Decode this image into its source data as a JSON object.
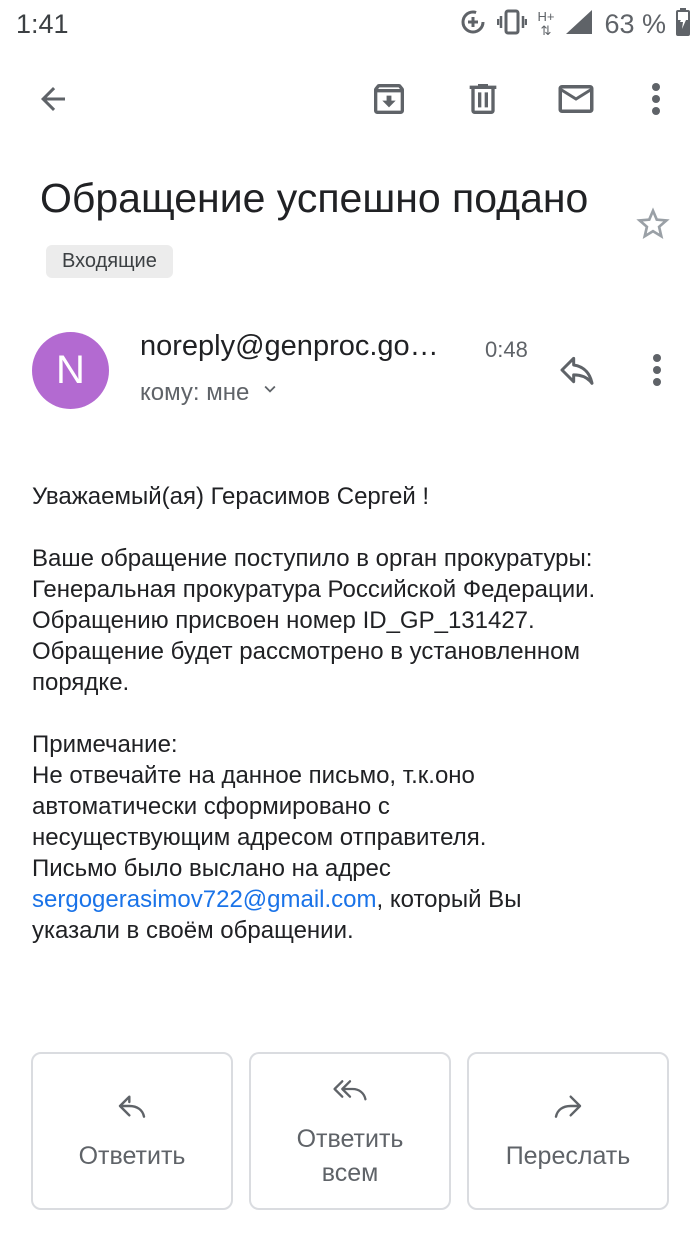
{
  "status_bar": {
    "time": "1:41",
    "network": "H+",
    "battery": "63 %"
  },
  "toolbar": {
    "back": "arrow-back-icon",
    "archive": "archive-icon",
    "delete": "delete-icon",
    "mark_unread": "mail-icon",
    "more": "more-vert-icon"
  },
  "subject": {
    "title": "Обращение успешно подано",
    "label": "Входящие"
  },
  "sender": {
    "initial": "N",
    "avatar_color": "#b36ad1",
    "email": "noreply@genproc.go…",
    "time": "0:48",
    "to": "кому: мне"
  },
  "body": {
    "greeting": "Уважаемый(ая) Герасимов Сергей !",
    "p1_l1": "Ваше обращение поступило в орган прокуратуры:",
    "p1_l2": "Генеральная прокуратура Российской Федерации.",
    "p1_l3": "Обращению присвоен номер ID_GP_131427.",
    "p1_l4": "Обращение будет рассмотрено в установленном",
    "p1_l5": "порядке.",
    "note_title": "Примечание:",
    "note_l1": "Не отвечайте на данное письмо, т.к.оно",
    "note_l2": "автоматически сформировано с",
    "note_l3": "несуществующим адресом отправителя.",
    "note_l4": "Письмо было выслано на адрес",
    "email_link": "sergogerasimov722@gmail.com",
    "note_l5_suffix": ", который Вы",
    "note_l6": "указали в своём обращении."
  },
  "actions": {
    "reply": "Ответить",
    "reply_all_l1": "Ответить",
    "reply_all_l2": "всем",
    "forward": "Переслать"
  }
}
